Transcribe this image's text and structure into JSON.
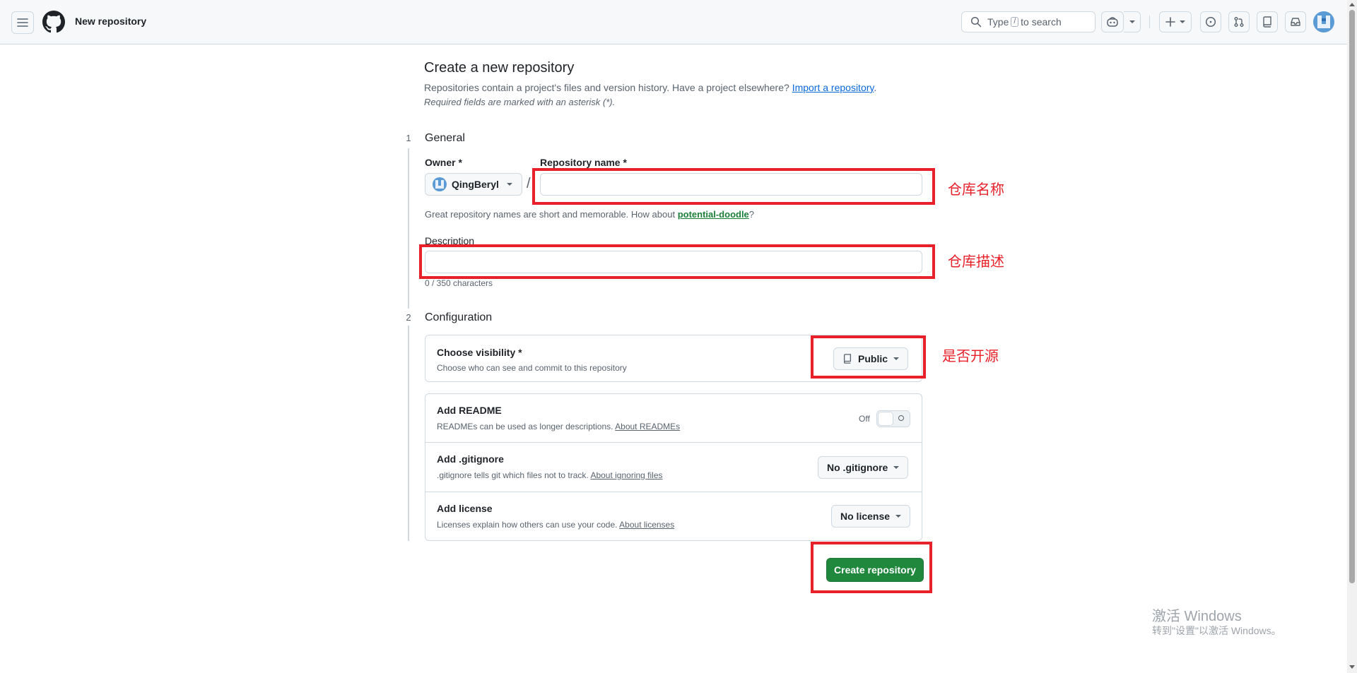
{
  "header": {
    "page_context": "New repository",
    "search": {
      "prefix": "Type",
      "key": "/",
      "suffix": "to search"
    }
  },
  "page": {
    "title": "Create a new repository",
    "subtitle": "Repositories contain a project's files and version history. Have a project elsewhere?",
    "import_link": "Import a repository",
    "subtitle_end": ".",
    "required_note": "Required fields are marked with an asterisk (*)."
  },
  "general": {
    "step": "1",
    "title": "General",
    "owner_label": "Owner *",
    "owner_value": "QingBeryl",
    "separator": "/",
    "repo_name_label": "Repository name *",
    "repo_name_value": "",
    "name_hint_prefix": "Great repository names are short and memorable. How about",
    "name_suggestion": "potential-doodle",
    "name_hint_suffix": "?",
    "description_label": "Description",
    "description_value": "",
    "description_counter": "0 / 350 characters"
  },
  "configuration": {
    "step": "2",
    "title": "Configuration",
    "visibility": {
      "title": "Choose visibility *",
      "desc": "Choose who can see and commit to this repository",
      "value": "Public"
    },
    "readme": {
      "title": "Add README",
      "desc": "READMEs can be used as longer descriptions.",
      "link": "About READMEs",
      "toggle_label": "Off",
      "enabled": false
    },
    "gitignore": {
      "title": "Add .gitignore",
      "desc": ".gitignore tells git which files not to track.",
      "link": "About ignoring files",
      "value": "No .gitignore"
    },
    "license": {
      "title": "Add license",
      "desc": "Licenses explain how others can use your code.",
      "link": "About licenses",
      "value": "No license"
    }
  },
  "actions": {
    "create_label": "Create repository"
  },
  "annotations": {
    "repo_name_note": "仓库名称",
    "description_note": "仓库描述",
    "visibility_note": "是否开源",
    "color": "#e8202a"
  },
  "watermark": {
    "line1": "激活 Windows",
    "line2": "转到\"设置\"以激活 Windows。"
  },
  "colors": {
    "accent": "#1f883d",
    "link": "#0969da",
    "suggestion": "#1a7f37"
  }
}
